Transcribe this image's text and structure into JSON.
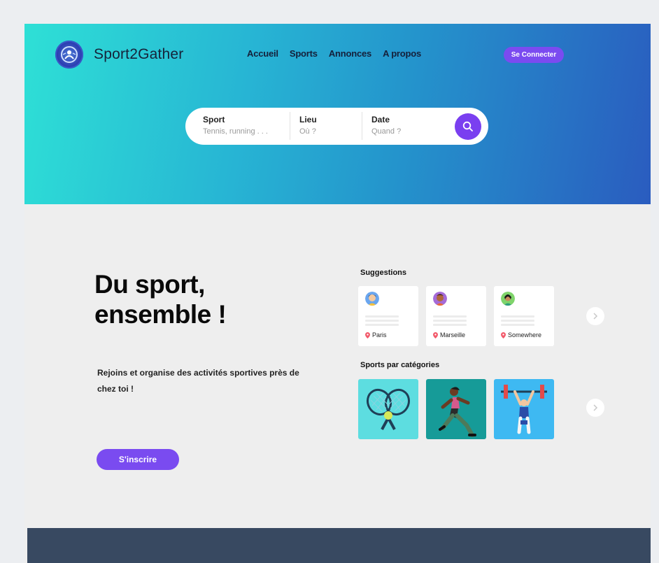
{
  "brand": {
    "name": "Sport2Gather"
  },
  "nav": {
    "items": [
      "Accueil",
      "Sports",
      "Annonces",
      "A propos"
    ]
  },
  "header": {
    "connect_label": "Se Connecter"
  },
  "search": {
    "sport_label": "Sport",
    "sport_placeholder": "Tennis, running . . .",
    "lieu_label": "Lieu",
    "lieu_placeholder": "Où ?",
    "date_label": "Date",
    "date_placeholder": "Quand ?"
  },
  "hero": {
    "title_line1": "Du sport,",
    "title_line2": "ensemble !",
    "subtitle": "Rejoins et organise des  activités sportives près de chez toi !",
    "signup_label": "S'inscrire"
  },
  "suggestions": {
    "title": "Suggestions",
    "cards": [
      {
        "location": "Paris"
      },
      {
        "location": "Marseille"
      },
      {
        "location": "Somewhere"
      }
    ]
  },
  "categories": {
    "title": "Sports par catégories",
    "tiles": [
      {
        "sport": "tennis",
        "color": "#5ddde0"
      },
      {
        "sport": "running",
        "color": "#169b98"
      },
      {
        "sport": "weightlifting",
        "color": "#3eb9f2"
      }
    ]
  },
  "colors": {
    "accent": "#7a4bf0",
    "footer": "#384961"
  },
  "icons": [
    "logo-emblem-icon",
    "search-icon",
    "location-pin-icon",
    "chevron-right-icon"
  ]
}
